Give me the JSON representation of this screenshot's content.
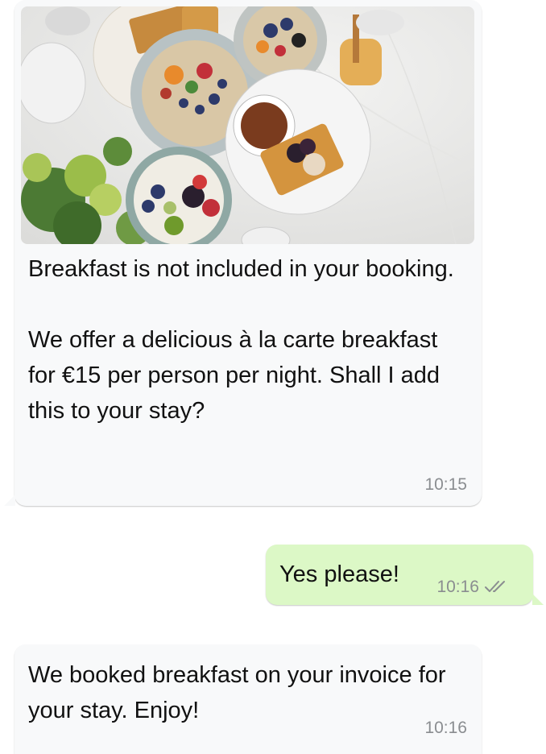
{
  "messages": [
    {
      "direction": "incoming",
      "has_image": true,
      "image_subject": "breakfast spread with porridge bowls, berries, waffles, coffee and honey",
      "text": "Breakfast is not included in your booking.\n\nWe offer a delicious à la carte breakfast for €15 per person per night. Shall I add this to your stay?",
      "time": "10:15"
    },
    {
      "direction": "outgoing",
      "text": "Yes please!",
      "time": "10:16",
      "status_icon": "double-check-icon"
    },
    {
      "direction": "incoming",
      "text": "We booked breakfast on your invoice for your stay. Enjoy!",
      "time": "10:16"
    }
  ],
  "colors": {
    "incoming_bubble": "#f8f9fa",
    "outgoing_bubble": "#dcf8c6",
    "timestamp": "#8a8d90",
    "text": "#111111"
  }
}
